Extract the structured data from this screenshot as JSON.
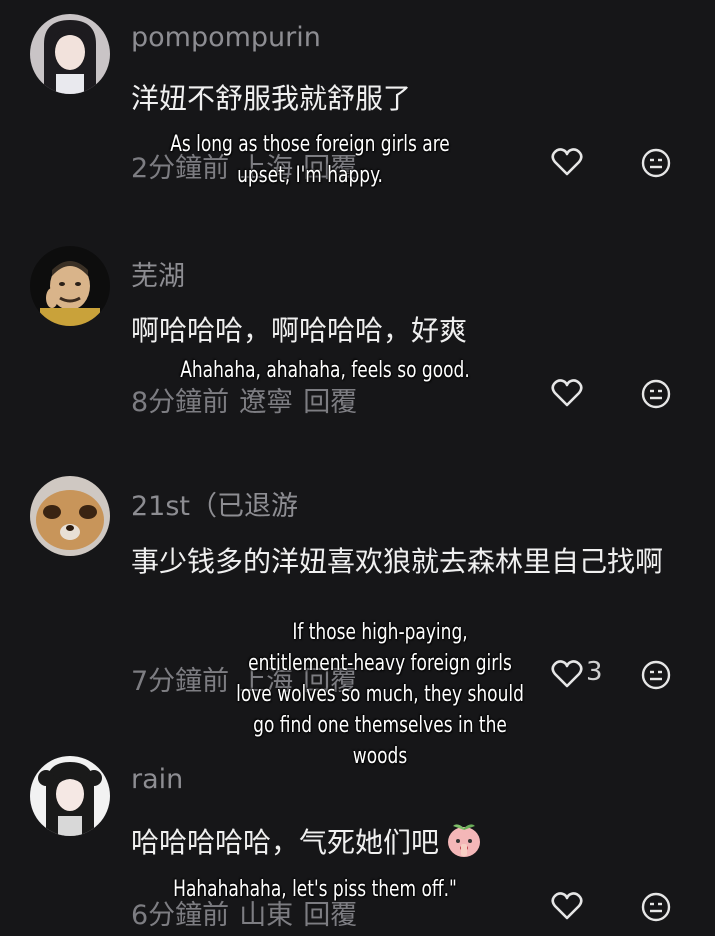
{
  "comments": [
    {
      "username": "pompompurin",
      "text": "洋妞不舒服我就舒服了",
      "time": "2分鐘前",
      "location": "上海",
      "reply": "回覆",
      "likes": "",
      "caption": [
        "As long as those foreign girls are",
        "upset, I'm happy."
      ]
    },
    {
      "username": "芜湖",
      "text": "啊哈哈哈，啊哈哈哈，好爽",
      "time": "8分鐘前",
      "location": "遼寧",
      "reply": "回覆",
      "likes": "",
      "caption": [
        "Ahahaha, ahahaha, feels so good."
      ]
    },
    {
      "username": "21st（已退游",
      "text": "事少钱多的洋妞喜欢狼就去森林里自己找啊",
      "time": "7分鐘前",
      "location": "上海",
      "reply": "回覆",
      "likes": "3",
      "caption": [
        "If those high-paying,",
        "entitlement-heavy foreign girls",
        "love wolves so much, they should",
        "go find one themselves in the",
        "woods"
      ]
    },
    {
      "username": "rain",
      "text": "哈哈哈哈哈，气死她们吧",
      "time": "6分鐘前",
      "location": "山東",
      "reply": "回覆",
      "likes": "",
      "caption": [
        "Hahahahaha, let's piss them off.\""
      ]
    }
  ],
  "icons": {
    "like": "heart-outline-icon",
    "reaction": "neutral-face-icon",
    "sticker": "peach-sticker-icon"
  },
  "colors": {
    "background": "#161618",
    "username": "#8d8d92",
    "text": "#f0f0f0",
    "meta": "#7d7d82"
  }
}
